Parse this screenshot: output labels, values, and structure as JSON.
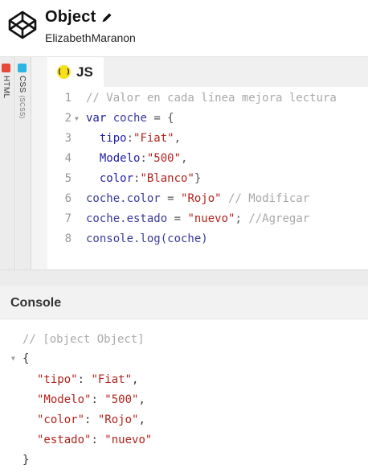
{
  "header": {
    "title": "Object",
    "author": "ElizabethMaranon",
    "icons": [
      "codepen-logo-icon",
      "pencil-icon"
    ]
  },
  "side_tabs": [
    {
      "label": "HTML",
      "color": "#e5493b"
    },
    {
      "label": "CSS",
      "sub": "(SCSS)",
      "color": "#2bb5e0"
    }
  ],
  "editor": {
    "tab_label": "JS",
    "badge": "( )",
    "lines": [
      {
        "n": "1",
        "parts": [
          [
            "comment",
            "// Valor en cada línea mejora lectura"
          ]
        ]
      },
      {
        "n": "2",
        "fold": true,
        "parts": [
          [
            "kw",
            "var"
          ],
          [
            "plain",
            " coche "
          ],
          [
            "punc",
            "= {"
          ]
        ]
      },
      {
        "n": "3",
        "parts": [
          [
            "prop",
            "  tipo"
          ],
          [
            "punc",
            ":"
          ],
          [
            "str",
            "\"Fiat\""
          ],
          [
            "punc",
            ","
          ]
        ]
      },
      {
        "n": "4",
        "parts": [
          [
            "prop",
            "  Modelo"
          ],
          [
            "punc",
            ":"
          ],
          [
            "str",
            "\"500\""
          ],
          [
            "punc",
            ","
          ]
        ]
      },
      {
        "n": "5",
        "parts": [
          [
            "prop",
            "  color"
          ],
          [
            "punc",
            ":"
          ],
          [
            "str",
            "\"Blanco\""
          ],
          [
            "punc",
            "}"
          ]
        ]
      },
      {
        "n": "6",
        "parts": [
          [
            "plain",
            "coche.color "
          ],
          [
            "punc",
            "= "
          ],
          [
            "str",
            "\"Rojo\""
          ],
          [
            "comment",
            " // Modificar"
          ]
        ]
      },
      {
        "n": "7",
        "parts": [
          [
            "plain",
            "coche.estado "
          ],
          [
            "punc",
            "= "
          ],
          [
            "str",
            "\"nuevo\""
          ],
          [
            "punc",
            "; "
          ],
          [
            "comment",
            "//Agregar"
          ]
        ]
      },
      {
        "n": "8",
        "parts": [
          [
            "plain",
            "console.log(coche)"
          ]
        ]
      }
    ]
  },
  "console": {
    "title": "Console",
    "comment": "// [object Object]",
    "open_brace": "{",
    "entries": [
      {
        "key": "\"tipo\"",
        "value": "\"Fiat\"",
        "sep": ","
      },
      {
        "key": "\"Modelo\"",
        "value": "\"500\"",
        "sep": ","
      },
      {
        "key": "\"color\"",
        "value": "\"Rojo\"",
        "sep": ","
      },
      {
        "key": "\"estado\"",
        "value": "\"nuevo\"",
        "sep": ""
      }
    ],
    "close_brace": "}"
  },
  "colors": {
    "js_badge": "#f7df1e",
    "string": "#b1231c",
    "keyword": "#1f1fa6",
    "comment": "#a8a8a8"
  }
}
